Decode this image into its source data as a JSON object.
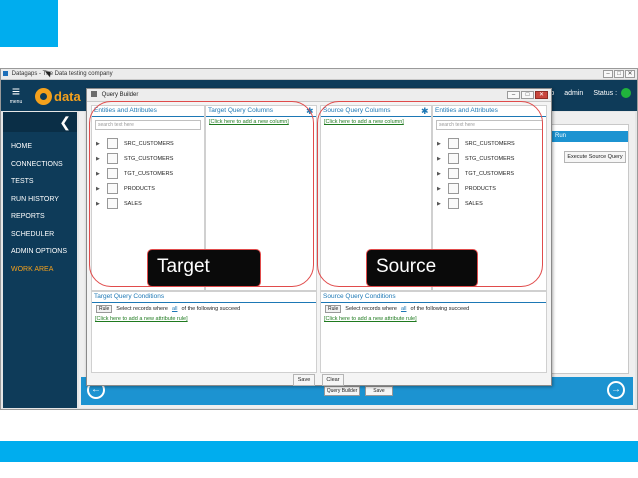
{
  "colors": {
    "accent": "#00adee",
    "app_dark": "#0e3b59",
    "logo_orange": "#f5a11c",
    "link_blue": "#1d78b5",
    "link_green": "#1f7a1f",
    "status_green": "#20b33c",
    "highlight_red": "#e04b4b"
  },
  "app_window": {
    "title": "Datagaps - The Data testing company",
    "controls": [
      "–",
      "□",
      "✕"
    ]
  },
  "app_header": {
    "menu_label": "menu",
    "logo_text": "data",
    "user_fragment": "p",
    "user": "admin",
    "status_label": "Status :",
    "icons": [
      "hamburger-icon",
      "logo-icon",
      "status-dot-icon"
    ]
  },
  "sidebar": {
    "collapse_symbol": "❮",
    "items": [
      {
        "label": "HOME"
      },
      {
        "label": "CONNECTIONS"
      },
      {
        "label": "TESTS"
      },
      {
        "label": "RUN HISTORY"
      },
      {
        "label": "REPORTS"
      },
      {
        "label": "SCHEDULER"
      },
      {
        "label": "ADMIN OPTIONS"
      },
      {
        "label": "WORK AREA"
      }
    ],
    "active_item": "WORK AREA"
  },
  "background_panel": {
    "run_header": "Run",
    "execute_button": "Execute Source Query",
    "bottom_qb_button": "Query Builder",
    "bottom_save_button": "Save",
    "prev_symbol": "←",
    "next_symbol": "→"
  },
  "query_builder": {
    "title": "Query Builder",
    "controls": [
      "–",
      "□",
      "✕"
    ],
    "left_entities": {
      "header": "Entities and Attributes",
      "search_placeholder": "search text here",
      "items": [
        "SRC_CUSTOMERS",
        "STG_CUSTOMERS",
        "TGT_CUSTOMERS",
        "PRODUCTS",
        "SALES"
      ]
    },
    "target_columns": {
      "header": "Target Query Columns",
      "add_link": "[Click here to add a new column]"
    },
    "source_columns": {
      "header": "Source Query Columns",
      "add_link": "[Click here to add a new column]"
    },
    "right_entities": {
      "header": "Entities and Attributes",
      "search_placeholder": "search text here",
      "items": [
        "SRC_CUSTOMERS",
        "STG_CUSTOMERS",
        "TGT_CUSTOMERS",
        "PRODUCTS",
        "SALES"
      ]
    },
    "target_conditions": {
      "header": "Target Query Conditions",
      "rule_button": "Rule",
      "text_before": "Select records where",
      "link": "all",
      "text_after": "of the following succeed",
      "add_link": "[Click here to add a new attribute rule]"
    },
    "source_conditions": {
      "header": "Source Query Conditions",
      "rule_button": "Rule",
      "text_before": "Select records where",
      "link": "all",
      "text_after": "of the following succeed",
      "add_link": "[Click here to add a new attribute rule]"
    },
    "save_button": "Save",
    "clear_button": "Clear"
  },
  "callouts": {
    "target": "Target",
    "source": "Source"
  }
}
